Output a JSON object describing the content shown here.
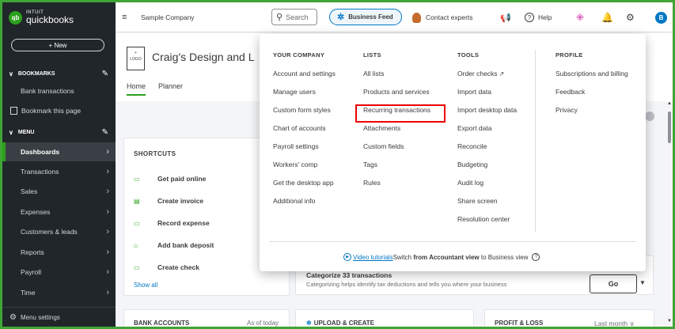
{
  "sidebar": {
    "logo_brand": "INTUIT",
    "logo_product": "quickbooks",
    "new_label": "+ New",
    "bookmarks_label": "BOOKMARKS",
    "bookmark_items": [
      "Bank transactions",
      "Bookmark this page"
    ],
    "menu_label": "MENU",
    "menu_items": [
      "Dashboards",
      "Transactions",
      "Sales",
      "Expenses",
      "Customers & leads",
      "Reports",
      "Payroll",
      "Time"
    ],
    "active_item": "Dashboards",
    "footer_label": "Menu settings"
  },
  "topbar": {
    "company": "Sample Company",
    "search_label": "Search",
    "business_feed": "Business Feed",
    "contact_experts": "Contact experts",
    "help": "Help",
    "avatar_initial": "B"
  },
  "page": {
    "logo_placeholder_plus": "+",
    "logo_placeholder_text": "LOGO",
    "company_name": "Craig's Design and L",
    "tabs": [
      "Home",
      "Planner"
    ],
    "active_tab": "Home"
  },
  "shortcuts": {
    "title": "SHORTCUTS",
    "items": [
      "Get paid online",
      "Create invoice",
      "Record expense",
      "Add bank deposit",
      "Create check"
    ],
    "show_all": "Show all"
  },
  "categorize": {
    "title": "Categorize 33 transactions",
    "subtitle": "Categorizing helps identify tax deductions and tells you where your business",
    "go_label": "Go"
  },
  "bottom_cards": {
    "bank_accounts": "BANK ACCOUNTS",
    "bank_period": "As of today",
    "upload_create": "UPLOAD & CREATE",
    "profit_loss": "PROFIT & LOSS",
    "pl_period": "Last month"
  },
  "menu": {
    "columns": [
      {
        "heading": "YOUR COMPANY",
        "items": [
          "Account and settings",
          "Manage users",
          "Custom form styles",
          "Chart of accounts",
          "Payroll settings",
          "Workers' comp",
          "Get the desktop app",
          "Additional info"
        ]
      },
      {
        "heading": "LISTS",
        "items": [
          "All lists",
          "Products and services",
          "Recurring transactions",
          "Attachments",
          "Custom fields",
          "Tags",
          "Rules"
        ]
      },
      {
        "heading": "TOOLS",
        "items": [
          "Order checks",
          "Import data",
          "Import desktop data",
          "Export data",
          "Reconcile",
          "Budgeting",
          "Audit log",
          "Share screen",
          "Resolution center"
        ]
      },
      {
        "heading": "PROFILE",
        "items": [
          "Subscriptions and billing",
          "Feedback",
          "Privacy"
        ]
      }
    ],
    "highlighted_item": "Recurring transactions",
    "footer": {
      "video_tutorials": "Video tutorials",
      "switch_prefix": "Switch",
      "switch_bold": "from Accountant view",
      "switch_suffix": "to Business view"
    }
  },
  "colors": {
    "brand_green": "#2ca01c",
    "sidebar_bg": "#21262a",
    "accent_blue": "#0077c5",
    "highlight_red": "#e00000"
  },
  "icons": [
    "search-icon",
    "sparkle-icon",
    "megaphone-icon",
    "help-icon",
    "apps-icon",
    "bell-icon",
    "gear-icon",
    "pencil-icon",
    "chevron-right-icon",
    "external-link-icon",
    "play-icon",
    "info-icon"
  ]
}
